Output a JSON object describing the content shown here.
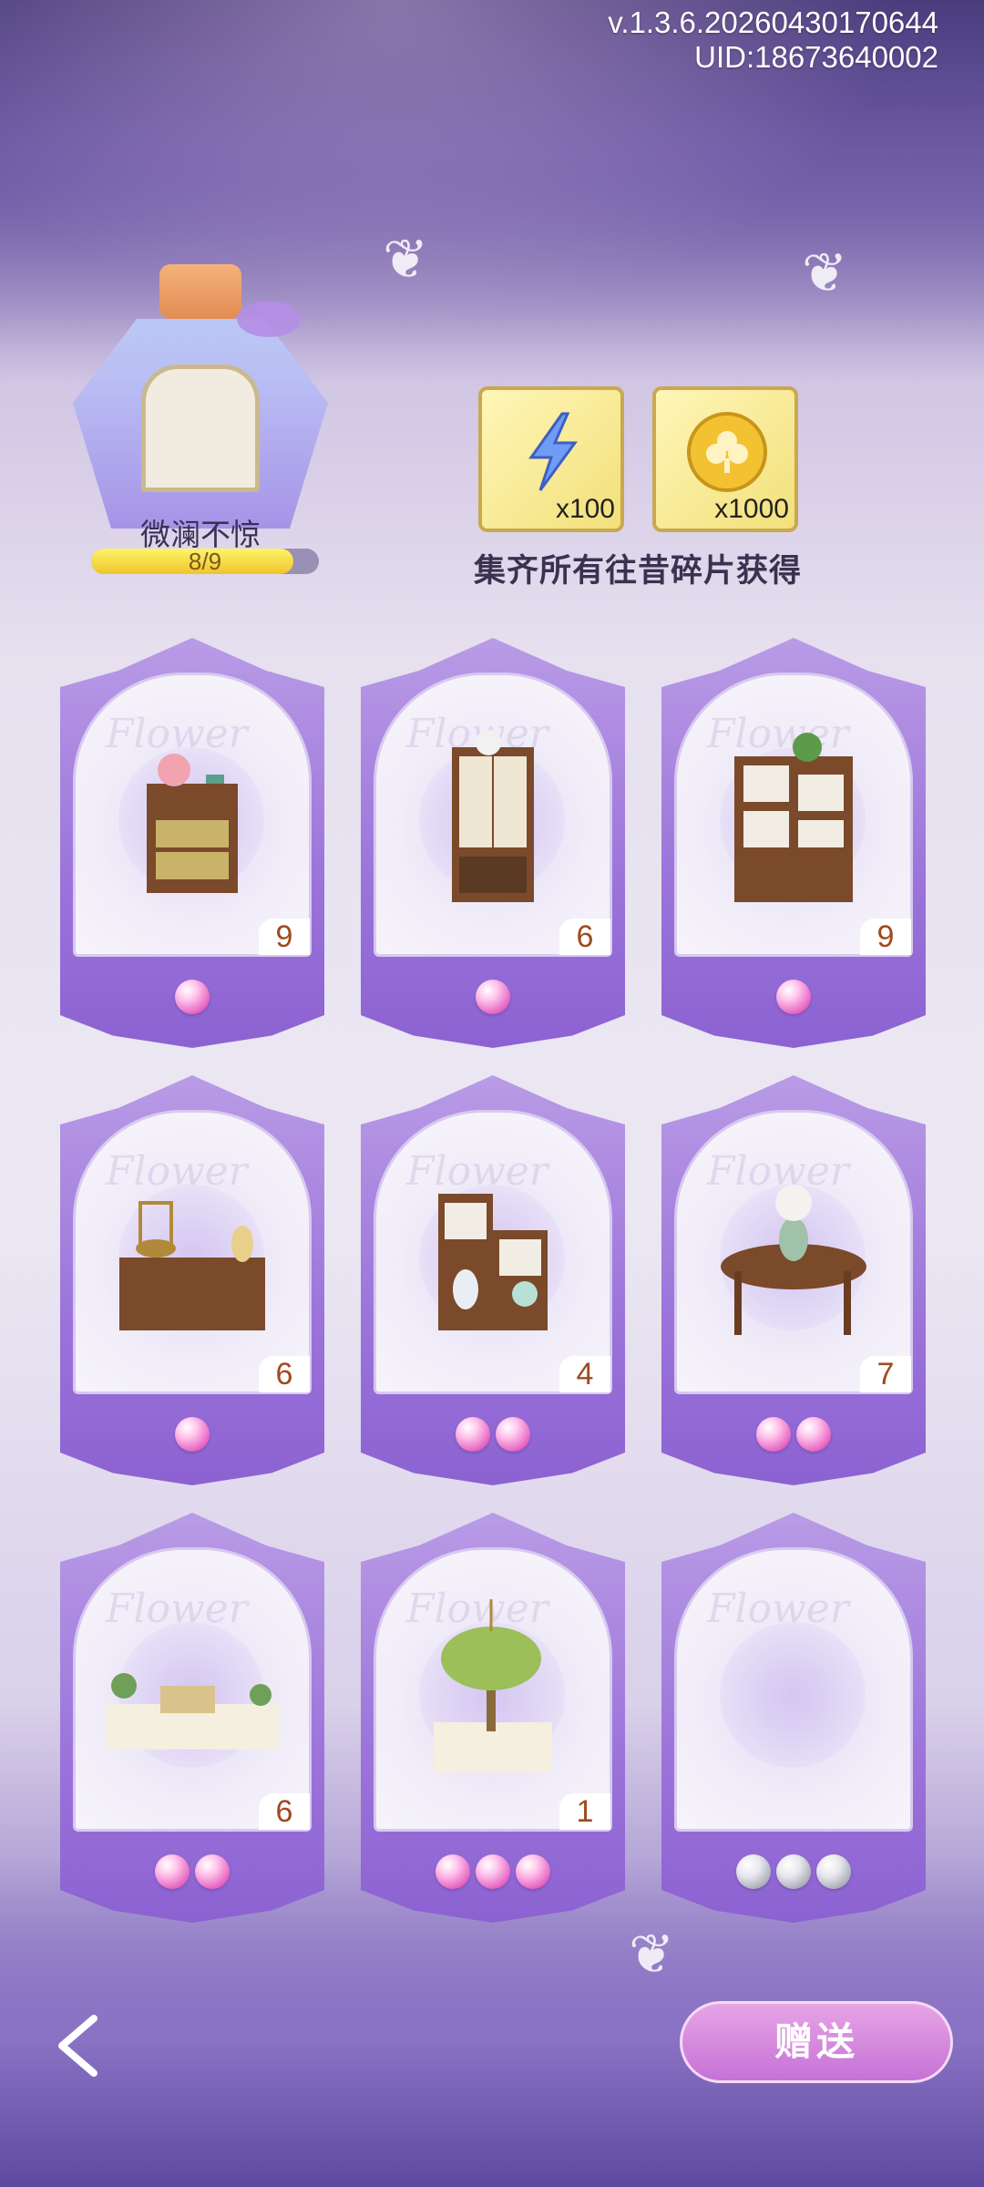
{
  "header": {
    "version": "v.1.3.6.20260430170644",
    "uid": "UID:18673640002"
  },
  "collection": {
    "name": "微澜不惊",
    "progress_text": "8/9",
    "progress_fraction": 0.889
  },
  "rewards": {
    "items": [
      {
        "icon": "lightning-icon",
        "count": "x100"
      },
      {
        "icon": "clover-coin-icon",
        "count": "x1000"
      }
    ],
    "caption": "集齐所有往昔碎片获得"
  },
  "cards": [
    {
      "item": "flower-cabinet",
      "count": "9",
      "pearls": 1,
      "pearl_color": "#e55fc0"
    },
    {
      "item": "tall-wardrobe",
      "count": "6",
      "pearls": 1,
      "pearl_color": "#e55fc0"
    },
    {
      "item": "display-shelf",
      "count": "9",
      "pearls": 1,
      "pearl_color": "#e55fc0"
    },
    {
      "item": "birdcage-sideboard",
      "count": "6",
      "pearls": 1,
      "pearl_color": "#e55fc0"
    },
    {
      "item": "vase-shelf",
      "count": "4",
      "pearls": 2,
      "pearl_color": "#e55fc0"
    },
    {
      "item": "console-table",
      "count": "7",
      "pearls": 2,
      "pearl_color": "#e55fc0"
    },
    {
      "item": "flower-counter",
      "count": "6",
      "pearls": 2,
      "pearl_color": "#e55fc0"
    },
    {
      "item": "palm-planter",
      "count": "1",
      "pearls": 3,
      "pearl_color": "#e55fc0"
    },
    {
      "item": "empty-slot",
      "count": "",
      "pearls": 3,
      "pearl_color": "#a5a5b4"
    }
  ],
  "card_watermark": "Flower",
  "controls": {
    "back_icon": "back-chevron-icon",
    "gift_label": "赠送"
  },
  "colors": {
    "accent": "#9b73da",
    "pearl_pink": "#e55fc0",
    "pearl_silver": "#a5a5b4",
    "gift_button": "#c672d6"
  }
}
